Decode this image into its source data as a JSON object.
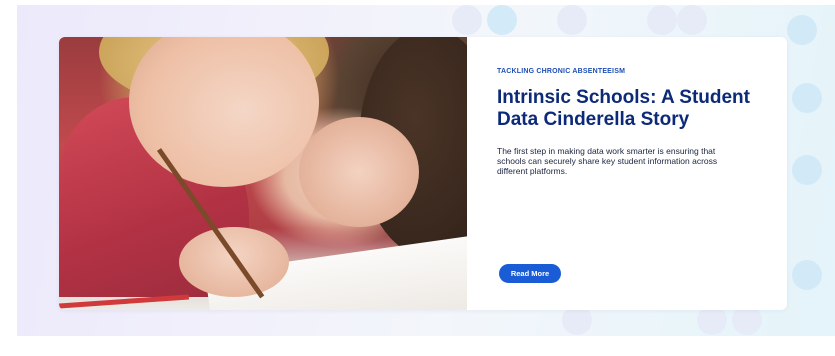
{
  "card": {
    "eyebrow": "TACKLING CHRONIC ABSENTEEISM",
    "title": "Intrinsic Schools: A Student Data Cinderella Story",
    "description": "The first step in making data work smarter is ensuring that schools can securely share key student information across different platforms.",
    "button_label": "Read More"
  },
  "colors": {
    "accent": "#1a5bd6",
    "title": "#0d2a78",
    "eyebrow": "#1d4fb8",
    "panel_bg": "#f1f0fb"
  }
}
